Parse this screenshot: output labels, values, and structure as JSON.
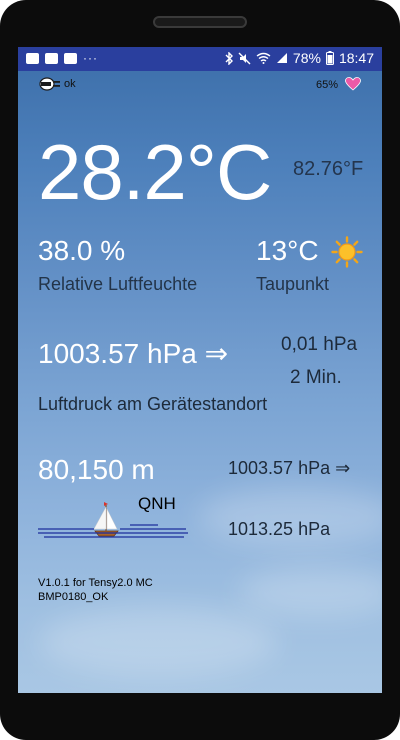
{
  "status_bar": {
    "battery_percent": "78%",
    "time": "18:47",
    "overflow": "···"
  },
  "header": {
    "connection_status": "ok",
    "battery_level": "65%"
  },
  "temperature": {
    "celsius": "28.2°C",
    "fahrenheit": "82.76°F"
  },
  "humidity": {
    "value": "38.0 %",
    "label": "Relative Luftfeuchte"
  },
  "dew_point": {
    "value": "13°C",
    "label": "Taupunkt",
    "icon": "sun-icon"
  },
  "pressure": {
    "value": "1003.57 hPa ⇒",
    "change": "0,01 hPa",
    "interval": "2 Min.",
    "label": "Luftdruck am Gerätestandort"
  },
  "altitude": {
    "value": "80,150 m",
    "qnh_label": "QNH",
    "pressure_local": "1003.57 hPa ⇒",
    "pressure_qnh": "1013.25 hPa"
  },
  "footer": {
    "version": "V1.0.1 for Tensy2.0 MC",
    "sensor_status": "BMP0180_OK"
  },
  "colors": {
    "status_bar": "#2a3f9e",
    "sky_top": "#3c6ea9",
    "sky_bottom": "#a9c7e4"
  }
}
